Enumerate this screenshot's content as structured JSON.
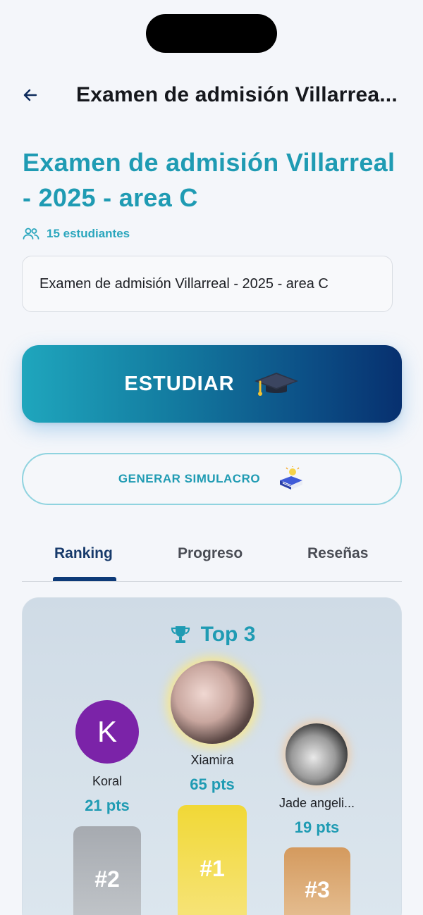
{
  "header": {
    "title": "Examen de admisión Villarrea..."
  },
  "exam": {
    "title": "Examen de admisión Villarreal - 2025 - area C",
    "students": "15 estudiantes",
    "description": "Examen de admisión Villarreal - 2025 - area C"
  },
  "actions": {
    "study_label": "ESTUDIAR",
    "simulation_label": "GENERAR SIMULACRO"
  },
  "tabs": [
    {
      "label": "Ranking",
      "active": true
    },
    {
      "label": "Progreso",
      "active": false
    },
    {
      "label": "Reseñas",
      "active": false
    }
  ],
  "ranking": {
    "heading": "Top 3",
    "podium": [
      {
        "position": "#2",
        "name": "Koral",
        "points": "21 pts",
        "avatar_letter": "K",
        "avatar_color": "#7b23a8"
      },
      {
        "position": "#1",
        "name": "Xiamira",
        "points": "65 pts",
        "avatar": "photo"
      },
      {
        "position": "#3",
        "name": "Jade angeli...",
        "points": "19 pts",
        "avatar": "photo"
      }
    ]
  },
  "colors": {
    "accent": "#1f9bb3",
    "tab_active": "#0d3a78",
    "gold": "#f1d836",
    "silver": "#a6aab0",
    "bronze": "#d49a5e"
  },
  "icons": {
    "back": "arrow-left-icon",
    "students": "users-icon",
    "study": "graduation-cap-icon",
    "simulation": "book-idea-icon",
    "trophy": "trophy-icon"
  }
}
